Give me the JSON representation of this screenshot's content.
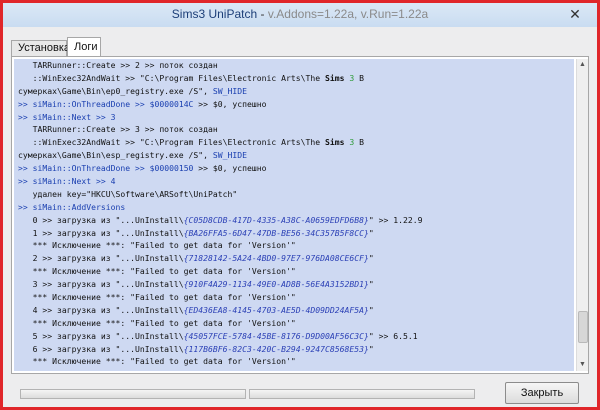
{
  "title": {
    "app": "Sims3 UniPatch",
    "separator": " - ",
    "version": "v.Addons=1.22a, v.Run=1.22a"
  },
  "close_glyph": "✕",
  "tabs": [
    {
      "label": "Установка",
      "active": false
    },
    {
      "label": "Логи",
      "active": true
    }
  ],
  "log_lines": [
    [
      {
        "t": "   TARRunner::Create >> 2 >> поток создан"
      }
    ],
    [
      {
        "t": "   ::WinExec32AndWait >> \"C:\\Program Files\\Electronic Arts\\The "
      },
      {
        "t": "Sims",
        "c": "b"
      },
      {
        "t": " "
      },
      {
        "t": "3",
        "c": "g"
      },
      {
        "t": " В"
      }
    ],
    [
      {
        "t": "сумерках\\Game\\Bin\\ep0_registry.exe /S\", "
      },
      {
        "t": "SW_HIDE",
        "c": "blue"
      }
    ],
    [
      {
        "t": ">> ",
        "c": "blue"
      },
      {
        "t": "siMain::OnThreadDone >> ",
        "c": "blue"
      },
      {
        "t": "$0000014C",
        "c": "blue"
      },
      {
        "t": " >> $0, успешно"
      }
    ],
    [
      {
        "t": ">> ",
        "c": "blue"
      },
      {
        "t": "siMain::Next >> 3",
        "c": "blue"
      }
    ],
    [
      {
        "t": "   TARRunner::Create >> 3 >> поток создан"
      }
    ],
    [
      {
        "t": "   ::WinExec32AndWait >> \"C:\\Program Files\\Electronic Arts\\The "
      },
      {
        "t": "Sims",
        "c": "b"
      },
      {
        "t": " "
      },
      {
        "t": "3",
        "c": "g"
      },
      {
        "t": " В"
      }
    ],
    [
      {
        "t": "сумерках\\Game\\Bin\\esp_registry.exe /S\", "
      },
      {
        "t": "SW_HIDE",
        "c": "blue"
      }
    ],
    [
      {
        "t": ">> ",
        "c": "blue"
      },
      {
        "t": "siMain::OnThreadDone >> ",
        "c": "blue"
      },
      {
        "t": "$00000150",
        "c": "blue"
      },
      {
        "t": " >> $0, успешно"
      }
    ],
    [
      {
        "t": ">> ",
        "c": "blue"
      },
      {
        "t": "siMain::Next >> 4",
        "c": "blue"
      }
    ],
    [
      {
        "t": "   удален key=\"HKCU\\Software\\ARSoft\\UniPatch\""
      }
    ],
    [
      {
        "t": ">> ",
        "c": "blue"
      },
      {
        "t": "siMain::AddVersions",
        "c": "blue"
      }
    ],
    [
      {
        "t": "   0 >> загрузка из \"...UnInstall\\"
      },
      {
        "t": "{C05D8CDB-417D-4335-A38C-A0659EDFD6B8}",
        "c": "guid"
      },
      {
        "t": "\" >> 1.22.9"
      }
    ],
    [
      {
        "t": "   1 >> загрузка из \"...UnInstall\\"
      },
      {
        "t": "{BA26FFA5-6D47-47DB-BE56-34C357B5F8CC}",
        "c": "guid"
      },
      {
        "t": "\""
      }
    ],
    [
      {
        "t": "   *** Исключение ***: \"Failed to get data for 'Version'\""
      }
    ],
    [
      {
        "t": "   2 >> загрузка из \"...UnInstall\\"
      },
      {
        "t": "{71828142-5A24-4BD0-97E7-976DA08CE6CF}",
        "c": "guid"
      },
      {
        "t": "\""
      }
    ],
    [
      {
        "t": "   *** Исключение ***: \"Failed to get data for 'Version'\""
      }
    ],
    [
      {
        "t": "   3 >> загрузка из \"...UnInstall\\"
      },
      {
        "t": "{910F4A29-1134-49E0-AD8B-56E4A3152BD1}",
        "c": "guid"
      },
      {
        "t": "\""
      }
    ],
    [
      {
        "t": "   *** Исключение ***: \"Failed to get data for 'Version'\""
      }
    ],
    [
      {
        "t": "   4 >> загрузка из \"...UnInstall\\"
      },
      {
        "t": "{ED436EA8-4145-4703-AE5D-4D09DD24AF5A}",
        "c": "guid"
      },
      {
        "t": "\""
      }
    ],
    [
      {
        "t": "   *** Исключение ***: \"Failed to get data for 'Version'\""
      }
    ],
    [
      {
        "t": "   5 >> загрузка из \"...UnInstall\\"
      },
      {
        "t": "{45057FCE-5784-45BE-8176-D9D00AF56C3C}",
        "c": "guid"
      },
      {
        "t": "\" >> 6.5.1"
      }
    ],
    [
      {
        "t": "   6 >> загрузка из \"...UnInstall\\"
      },
      {
        "t": "{117B6BF6-82C3-420C-B294-9247C8568E53}",
        "c": "guid"
      },
      {
        "t": "\""
      }
    ],
    [
      {
        "t": "   *** Исключение ***: \"Failed to get data for 'Version'\""
      }
    ]
  ],
  "scrollbar": {
    "position_fraction": 0.93
  },
  "close_button": "Закрыть",
  "colors": {
    "border": "#e0262a",
    "log_bg": "#ced9f2",
    "blue_text": "#1a3fb0",
    "green_text": "#2f9b3a"
  }
}
